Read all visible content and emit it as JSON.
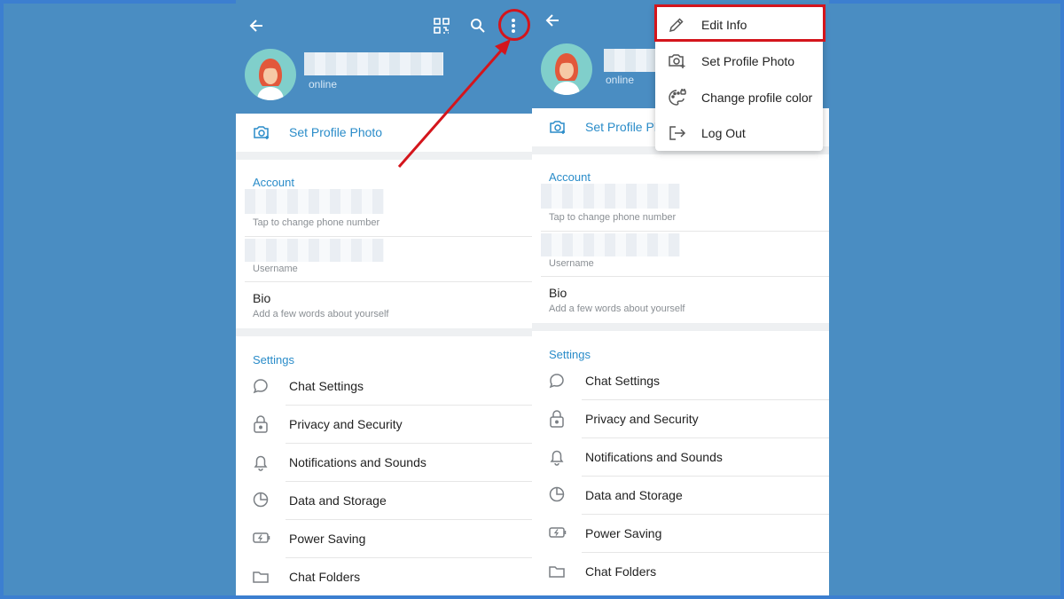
{
  "left_screen": {
    "status": "online",
    "set_photo": "Set Profile Photo",
    "account_header": "Account",
    "phone_hint": "Tap to change phone number",
    "username_hint": "Username",
    "bio_title": "Bio",
    "bio_hint": "Add a few words about yourself",
    "settings_header": "Settings",
    "settings": [
      {
        "label": "Chat Settings",
        "icon": "chat-bubble-icon"
      },
      {
        "label": "Privacy and Security",
        "icon": "lock-icon"
      },
      {
        "label": "Notifications and Sounds",
        "icon": "bell-icon"
      },
      {
        "label": "Data and Storage",
        "icon": "pie-clock-icon"
      },
      {
        "label": "Power Saving",
        "icon": "battery-bolt-icon"
      },
      {
        "label": "Chat Folders",
        "icon": "folder-icon"
      }
    ]
  },
  "right_screen": {
    "status": "online",
    "set_photo": "Set Profile Ph",
    "account_header": "Account",
    "phone_hint": "Tap to change phone number",
    "username_hint": "Username",
    "bio_title": "Bio",
    "bio_hint": "Add a few words about yourself",
    "settings_header": "Settings",
    "settings": [
      {
        "label": "Chat Settings"
      },
      {
        "label": "Privacy and Security"
      },
      {
        "label": "Notifications and Sounds"
      },
      {
        "label": "Data and Storage"
      },
      {
        "label": "Power Saving"
      },
      {
        "label": "Chat Folders"
      }
    ]
  },
  "menu": {
    "items": [
      {
        "label": "Edit Info",
        "icon": "pencil-icon"
      },
      {
        "label": "Set Profile Photo",
        "icon": "camera-plus-icon"
      },
      {
        "label": "Change profile color",
        "icon": "palette-icon"
      },
      {
        "label": "Log Out",
        "icon": "logout-icon"
      }
    ]
  },
  "colors": {
    "header_bg": "#4a8dc2",
    "accent": "#2a8cc9",
    "annotation": "#d4151c"
  }
}
